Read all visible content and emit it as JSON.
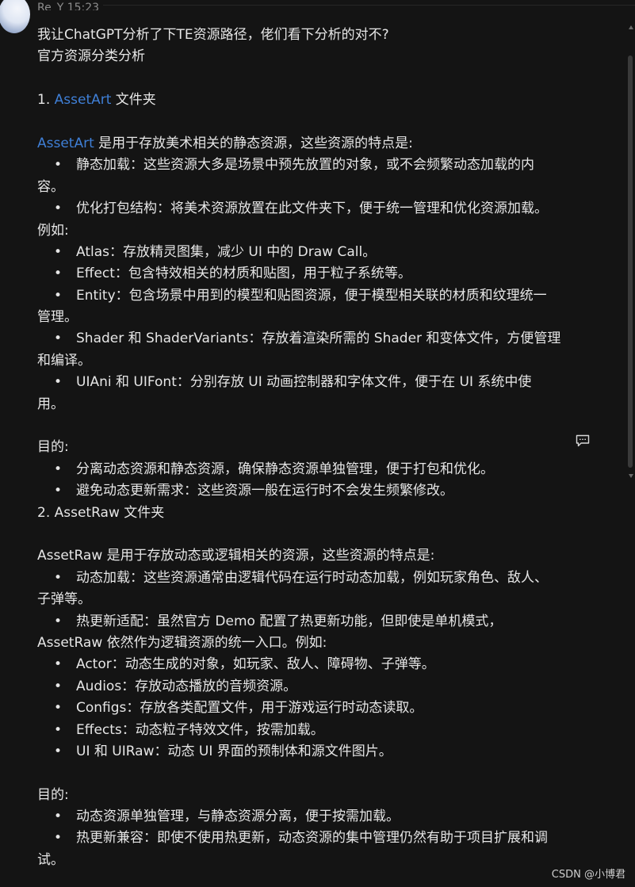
{
  "header": {
    "author": "Re_Y",
    "time": "15:23"
  },
  "message": {
    "question": "我让ChatGPT分析了下TE资源路径，佬们看下分析的对不?",
    "heading": "官方资源分类分析",
    "s1": {
      "num": "1.",
      "name": "AssetArt",
      "suffix": " 文件夹",
      "intro_name": "AssetArt",
      "intro_rest": " 是用于存放美术相关的静态资源，这些资源的特点是:",
      "b1a": "静态加载：这些资源大多是场景中预先放置的对象，或不会频繁动态加载的内",
      "b1b": "容。",
      "b2": "优化打包结构：将美术资源放置在此文件夹下，便于统一管理和优化资源加载。",
      "example": "例如:",
      "e1": "Atlas：存放精灵图集，减少 UI 中的 Draw Call。",
      "e2": "Effect：包含特效相关的材质和贴图，用于粒子系统等。",
      "e3a": "Entity：包含场景中用到的模型和贴图资源，便于模型相关联的材质和纹理统一",
      "e3b": "管理。",
      "e4a": "Shader 和 ShaderVariants：存放着渲染所需的 Shader 和变体文件，方便管理",
      "e4b": "和编译。",
      "e5a": "UIAni 和 UIFont：分别存放 UI 动画控制器和字体文件，便于在 UI 系统中使",
      "e5b": "用。",
      "purpose": "目的:",
      "p1": "分离动态资源和静态资源，确保静态资源单独管理，便于打包和优化。",
      "p2": "避免动态更新需求：这些资源一般在运行时不会发生频繁修改。"
    },
    "s2": {
      "title": "2. AssetRaw 文件夹",
      "intro": "AssetRaw 是用于存放动态或逻辑相关的资源，这些资源的特点是:",
      "b1a": "动态加载：这些资源通常由逻辑代码在运行时动态加载，例如玩家角色、敌人、",
      "b1b": "子弹等。",
      "b2a": "热更新适配：虽然官方 Demo 配置了热更新功能，但即使是单机模式，",
      "b2b": "AssetRaw 依然作为逻辑资源的统一入口。例如:",
      "e1": "Actor：动态生成的对象，如玩家、敌人、障碍物、子弹等。",
      "e2": "Audios：存放动态播放的音频资源。",
      "e3": "Configs：存放各类配置文件，用于游戏运行时动态读取。",
      "e4": "Effects：动态粒子特效文件，按需加载。",
      "e5": "UI 和 UIRaw：动态 UI 界面的预制体和源文件图片。",
      "purpose": "目的:",
      "p1": "动态资源单独管理，与静态资源分离，便于按需加载。",
      "p2a": "热更新兼容：即使不使用热更新，动态资源的集中管理仍然有助于项目扩展和调",
      "p2b": "试。"
    },
    "bullet": "•"
  },
  "watermark": "CSDN @小博君",
  "colors": {
    "background": "#141414",
    "text": "#e6e6e6",
    "link": "#3f7fd6",
    "muted": "#8c8c8c"
  },
  "icons": {
    "comment": "comment-icon",
    "avatar": "avatar"
  }
}
